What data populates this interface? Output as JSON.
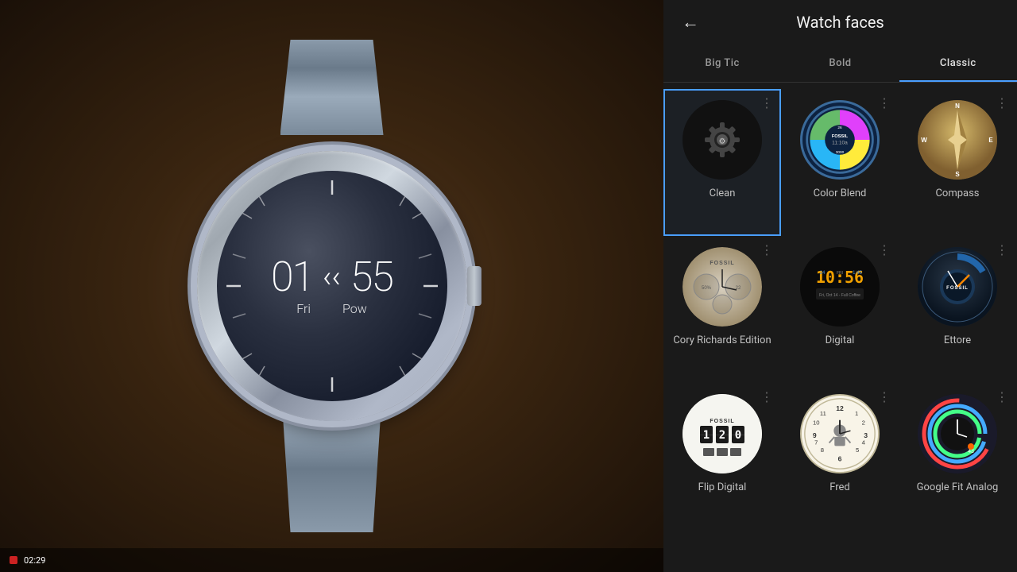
{
  "header": {
    "title": "Watch faces",
    "back_label": "←"
  },
  "tabs": [
    {
      "id": "big-tic",
      "label": "Big Tic",
      "active": false
    },
    {
      "id": "bold",
      "label": "Bold",
      "active": false
    },
    {
      "id": "classic",
      "label": "Classic",
      "active": true
    }
  ],
  "watch_display": {
    "hour": "01",
    "minutes": "55",
    "day": "Fri",
    "power": "Pow",
    "arrow": "‹"
  },
  "faces": [
    {
      "id": "clean",
      "name": "Clean",
      "selected": true,
      "type": "clean"
    },
    {
      "id": "color-blend",
      "name": "Color Blend",
      "selected": false,
      "type": "colorblend"
    },
    {
      "id": "compass",
      "name": "Compass",
      "selected": false,
      "type": "compass"
    },
    {
      "id": "cory-richards",
      "name": "Cory Richards Edition",
      "selected": false,
      "type": "cory"
    },
    {
      "id": "digital",
      "name": "Digital",
      "selected": false,
      "type": "digital"
    },
    {
      "id": "ettore",
      "name": "Ettore",
      "selected": false,
      "type": "ettore"
    },
    {
      "id": "flip-digital",
      "name": "Flip Digital",
      "selected": false,
      "type": "flip"
    },
    {
      "id": "fred",
      "name": "Fred",
      "selected": false,
      "type": "fred"
    },
    {
      "id": "google-fit-analog",
      "name": "Google Fit Analog",
      "selected": false,
      "type": "googlefit"
    }
  ],
  "notification": {
    "time": "02:29",
    "dot_color": "#cc2222"
  },
  "more_icon": "⋮"
}
